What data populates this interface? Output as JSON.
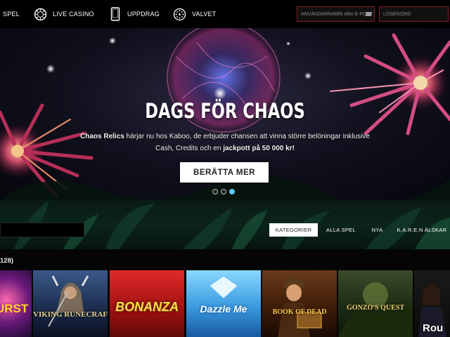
{
  "nav": {
    "items": [
      {
        "label": "SPEL",
        "icon": "menu-icon"
      },
      {
        "label": "LIVE CASINO",
        "icon": "casino-chip-icon"
      },
      {
        "label": "UPPDRAG",
        "icon": "phone-icon"
      },
      {
        "label": "VALVET",
        "icon": "vault-icon"
      }
    ],
    "username_placeholder": "ANVÄNDARNAMN eller E-POST",
    "password_placeholder": "LÖSENORD"
  },
  "hero": {
    "title": "DAGS FÖR CHAOS",
    "text_bold_1": "Chaos Relics",
    "text_1": " härjar nu hos Kaboo, de erbjuder chansen att vinna större belöningar inklusive",
    "text_2": "Cash, Credits och en ",
    "text_bold_2": "jackpott på 50 000 kr!",
    "button": "BERÄTTA MER",
    "slides": 3,
    "active_slide": 3
  },
  "categories": {
    "tabs": [
      "KATEGORIER",
      "ALLA SPEL",
      "NYA",
      "K.A.R.E.N ÄLSKAR"
    ],
    "active": "KATEGORIER"
  },
  "games": {
    "count": "128)",
    "tiles": [
      {
        "label": "URST"
      },
      {
        "label": "VIKING RUNECRAFT"
      },
      {
        "label": "BONANZA"
      },
      {
        "label": "Dazzle Me"
      },
      {
        "label": "BOOK OF DEAD"
      },
      {
        "label": "GONZO'S QUEST"
      },
      {
        "label": "Rou"
      }
    ]
  },
  "colors": {
    "accent": "#8b1d27",
    "active_dot": "#5cc8ff"
  }
}
